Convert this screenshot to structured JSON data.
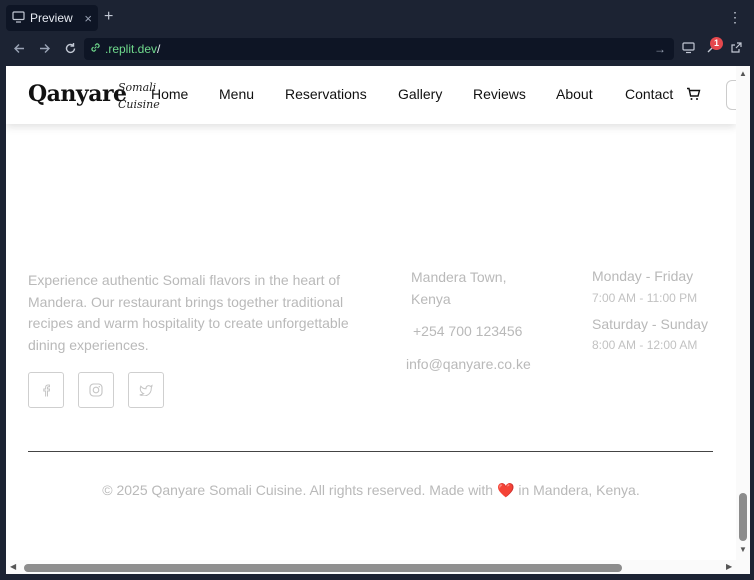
{
  "browser": {
    "tab_label": "Preview",
    "tab_close": "×",
    "new_tab": "+",
    "menu": "⋮",
    "url_domain": ".replit.dev",
    "url_path": "/",
    "notification_count": "1"
  },
  "site": {
    "logo": "Qanyare",
    "logo_sub_1": "Somali",
    "logo_sub_2": "Cuisine",
    "nav": [
      "Home",
      "Menu",
      "Reservations",
      "Gallery",
      "Reviews",
      "About",
      "Contact"
    ]
  },
  "footer": {
    "about_text": "Experience authentic Somali flavors in the heart of Mandera. Our restaurant brings together traditional recipes and warm hospitality to create unforgettable dining experiences.",
    "social_icons": [
      "facebook-icon",
      "instagram-icon",
      "twitter-icon"
    ],
    "address_line1": "Mandera Town,",
    "address_line2": "Kenya",
    "phone": "+254 700 123456",
    "email": "info@qanyare.co.ke",
    "hours": [
      {
        "day": "Monday - Friday",
        "time": "7:00 AM - 11:00 PM"
      },
      {
        "day": "Saturday - Sunday",
        "time": "8:00 AM - 12:00 AM"
      }
    ],
    "copyright_before": "© 2025 Qanyare Somali Cuisine. All rights reserved. Made with",
    "copyright_heart": "❤️",
    "copyright_after": "in Mandera, Kenya."
  }
}
